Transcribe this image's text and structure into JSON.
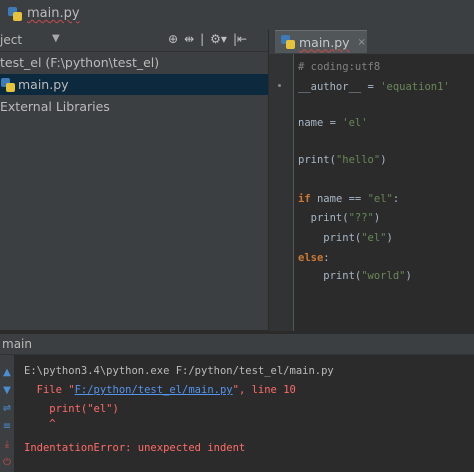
{
  "title_bar": {
    "file_name": "main.py"
  },
  "project_panel": {
    "header_label": "ject",
    "dropdown": "▼",
    "tools": [
      "⊕",
      "⇹",
      "|",
      "⚙▾",
      "|⇤"
    ],
    "tree": [
      {
        "label": "test_el (F:\\python\\test_el)"
      },
      {
        "label": "main.py"
      },
      {
        "label": "External Libraries"
      }
    ]
  },
  "editor": {
    "tab_label": "main.py",
    "tab_close": "×",
    "code": [
      {
        "parts": [
          {
            "t": "# coding:utf8",
            "c": "cm"
          }
        ]
      },
      {
        "parts": [
          {
            "t": "__author__",
            "c": "id"
          },
          {
            "t": " = ",
            "c": "op"
          },
          {
            "t": "'equation1'",
            "c": "str"
          }
        ]
      },
      {
        "parts": []
      },
      {
        "parts": [
          {
            "t": "name",
            "c": "id"
          },
          {
            "t": " = ",
            "c": "op"
          },
          {
            "t": "'el'",
            "c": "str"
          }
        ]
      },
      {
        "parts": []
      },
      {
        "parts": [
          {
            "t": "print(",
            "c": "id"
          },
          {
            "t": "\"hello\"",
            "c": "str"
          },
          {
            "t": ")",
            "c": "id"
          }
        ]
      },
      {
        "parts": []
      },
      {
        "parts": [
          {
            "t": "if",
            "c": "kw"
          },
          {
            "t": " name == ",
            "c": "id"
          },
          {
            "t": "\"el\"",
            "c": "str"
          },
          {
            "t": ":",
            "c": "id"
          }
        ]
      },
      {
        "parts": [
          {
            "t": "  print(",
            "c": "id"
          },
          {
            "t": "\"??\"",
            "c": "str"
          },
          {
            "t": ")",
            "c": "id"
          }
        ]
      },
      {
        "parts": [
          {
            "t": "    print(",
            "c": "id"
          },
          {
            "t": "\"el\"",
            "c": "str"
          },
          {
            "t": ")",
            "c": "id"
          }
        ]
      },
      {
        "parts": [
          {
            "t": "else",
            "c": "kw"
          },
          {
            "t": ":",
            "c": "id"
          }
        ]
      },
      {
        "parts": [
          {
            "t": "    print(",
            "c": "id"
          },
          {
            "t": "\"world\"",
            "c": "str"
          },
          {
            "t": ")",
            "c": "id"
          }
        ]
      }
    ]
  },
  "run_panel": {
    "header_label": "main",
    "side_icons": [
      "▲",
      "▼",
      "⇌",
      "≡",
      "⤓",
      "⏻"
    ],
    "output": {
      "command": "E:\\python3.4\\python.exe F:/python/test_el/main.py",
      "file_prefix": "  File \"",
      "file_link": "F:/python/test_el/main.py",
      "file_suffix": "\", line 10",
      "code_line": "    print(\"el\")",
      "caret": "    ^",
      "error": "IndentationError: unexpected indent"
    }
  },
  "colors": {
    "error": "#ff6b68",
    "link": "#5394ec",
    "string": "#6a8759",
    "keyword": "#cc7832"
  }
}
